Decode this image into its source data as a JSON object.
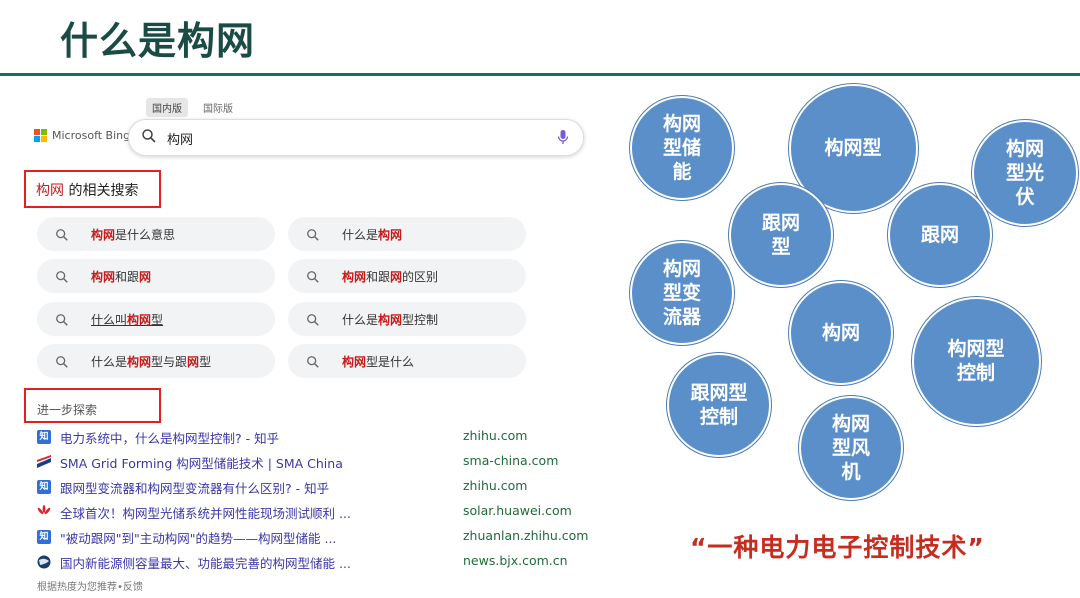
{
  "slide_title": "什么是构网",
  "search": {
    "region_tabs": [
      "国内版",
      "国际版"
    ],
    "logo_text": "Microsoft Bing",
    "query": "构网"
  },
  "related": {
    "keyword": "构网",
    "suffix": " 的相关搜索",
    "items": [
      {
        "parts": [
          {
            "t": "构网",
            "b": true
          },
          {
            "t": "是什么意思",
            "b": false
          }
        ]
      },
      {
        "parts": [
          {
            "t": "什么是",
            "b": false
          },
          {
            "t": "构网",
            "b": true
          }
        ]
      },
      {
        "parts": [
          {
            "t": "构网",
            "b": true
          },
          {
            "t": "和跟",
            "b": false
          },
          {
            "t": "网",
            "b": true
          }
        ]
      },
      {
        "parts": [
          {
            "t": "构网",
            "b": true
          },
          {
            "t": "和跟",
            "b": false
          },
          {
            "t": "网",
            "b": true
          },
          {
            "t": "的区别",
            "b": false
          }
        ]
      },
      {
        "parts": [
          {
            "t": "什么叫",
            "b": false
          },
          {
            "t": "构网",
            "b": true
          },
          {
            "t": "型",
            "b": false
          }
        ]
      },
      {
        "parts": [
          {
            "t": "什么是",
            "b": false
          },
          {
            "t": "构网",
            "b": true
          },
          {
            "t": "型控制",
            "b": false
          }
        ]
      },
      {
        "parts": [
          {
            "t": "什么是",
            "b": false
          },
          {
            "t": "构网",
            "b": true
          },
          {
            "t": "型与跟",
            "b": false
          },
          {
            "t": "网",
            "b": true
          },
          {
            "t": "型",
            "b": false
          }
        ]
      },
      {
        "parts": [
          {
            "t": "构网",
            "b": true
          },
          {
            "t": "型是什么",
            "b": false
          }
        ]
      }
    ]
  },
  "explore": {
    "title": "进一步探索",
    "results": [
      {
        "icon": "zhihu-icon",
        "icon_text": "知",
        "color": "#2f6fd6",
        "title": "电力系统中，什么是构网型控制? - 知乎",
        "domain": "zhihu.com"
      },
      {
        "icon": "sma-icon",
        "icon_text": "",
        "color": "#1e3a8a",
        "title": "SMA Grid Forming 构网型储能技术 | SMA China",
        "domain": "sma-china.com"
      },
      {
        "icon": "zhihu-icon",
        "icon_text": "知",
        "color": "#2f6fd6",
        "title": "跟网型变流器和构网型变流器有什么区别?  - 知乎",
        "domain": "zhihu.com"
      },
      {
        "icon": "huawei-icon",
        "icon_text": "",
        "color": "#d7262b",
        "title": "全球首次！构网型光储系统并网性能现场测试顺利 ...",
        "domain": "solar.huawei.com"
      },
      {
        "icon": "zhihu-icon",
        "icon_text": "知",
        "color": "#2f6fd6",
        "title": "\"被动跟网\"到\"主动构网\"的趋势——构网型储能 ...",
        "domain": "zhuanlan.zhihu.com"
      },
      {
        "icon": "globe-icon",
        "icon_text": "",
        "color": "#1a3d6b",
        "title": "国内新能源侧容量最大、功能最完善的构网型储能 ...",
        "domain": "news.bjx.com.cn"
      }
    ],
    "footnote": "根据热度为您推荐•反馈"
  },
  "bubbles": [
    "构网\n型储\n能",
    "构网型",
    "构网\n型光\n伏",
    "跟网\n型",
    "跟网",
    "构网\n型变\n流器",
    "构网",
    "构网型\n控制",
    "跟网型\n控制",
    "构网\n型风\n机"
  ],
  "slogan": "“一种电力电子控制技术”",
  "colors": {
    "title": "#1a4b45",
    "rule": "#1f6b5f",
    "bubble": "#5b8fca",
    "highlight": "#c61b1b",
    "box": "#e32020",
    "slogan": "#c62d1e",
    "link": "#3b38a6"
  }
}
